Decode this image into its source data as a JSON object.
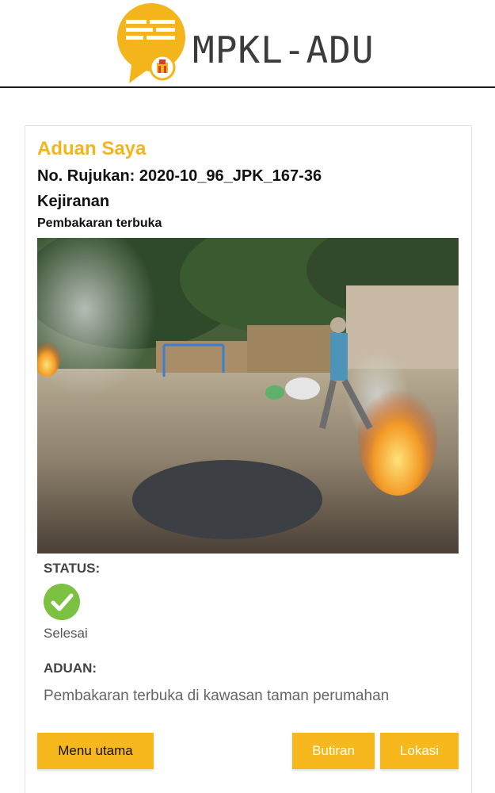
{
  "header": {
    "app_name": "MPKL-ADU",
    "logo_icon": "speech-bubble-logo-icon",
    "brand_color": "#f4b51c"
  },
  "complaint": {
    "title": "Aduan Saya",
    "reference": "No. Rujukan: 2020-10_96_JPK_167-36",
    "category": "Kejiranan",
    "subcategory": "Pembakaran terbuka",
    "photo": "open-burning-photo"
  },
  "status": {
    "label": "STATUS:",
    "icon": "check-circle-icon",
    "icon_color": "#7cc142",
    "value": "Selesai"
  },
  "aduan": {
    "label": "ADUAN:",
    "text": "Pembakaran terbuka di kawasan taman perumahan"
  },
  "buttons": {
    "menu_label": "Menu utama",
    "butiran_label": "Butiran",
    "lokasi_label": "Lokasi",
    "button_color": "#f7b81e"
  }
}
